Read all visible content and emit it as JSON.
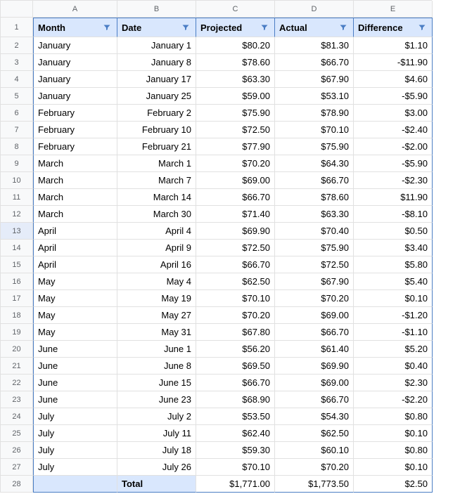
{
  "columns": [
    "A",
    "B",
    "C",
    "D",
    "E"
  ],
  "headers": [
    "Month",
    "Date",
    "Projected",
    "Actual",
    "Difference"
  ],
  "selected_row": 13,
  "rows": [
    {
      "n": 2,
      "month": "January",
      "date": "January 1",
      "proj": "$80.20",
      "act": "$81.30",
      "diff": "$1.10"
    },
    {
      "n": 3,
      "month": "January",
      "date": "January 8",
      "proj": "$78.60",
      "act": "$66.70",
      "diff": "-$11.90"
    },
    {
      "n": 4,
      "month": "January",
      "date": "January 17",
      "proj": "$63.30",
      "act": "$67.90",
      "diff": "$4.60"
    },
    {
      "n": 5,
      "month": "January",
      "date": "January 25",
      "proj": "$59.00",
      "act": "$53.10",
      "diff": "-$5.90"
    },
    {
      "n": 6,
      "month": "February",
      "date": "February 2",
      "proj": "$75.90",
      "act": "$78.90",
      "diff": "$3.00"
    },
    {
      "n": 7,
      "month": "February",
      "date": "February 10",
      "proj": "$72.50",
      "act": "$70.10",
      "diff": "-$2.40"
    },
    {
      "n": 8,
      "month": "February",
      "date": "February 21",
      "proj": "$77.90",
      "act": "$75.90",
      "diff": "-$2.00"
    },
    {
      "n": 9,
      "month": "March",
      "date": "March 1",
      "proj": "$70.20",
      "act": "$64.30",
      "diff": "-$5.90"
    },
    {
      "n": 10,
      "month": "March",
      "date": "March 7",
      "proj": "$69.00",
      "act": "$66.70",
      "diff": "-$2.30"
    },
    {
      "n": 11,
      "month": "March",
      "date": "March 14",
      "proj": "$66.70",
      "act": "$78.60",
      "diff": "$11.90"
    },
    {
      "n": 12,
      "month": "March",
      "date": "March 30",
      "proj": "$71.40",
      "act": "$63.30",
      "diff": "-$8.10"
    },
    {
      "n": 13,
      "month": "April",
      "date": "April 4",
      "proj": "$69.90",
      "act": "$70.40",
      "diff": "$0.50"
    },
    {
      "n": 14,
      "month": "April",
      "date": "April 9",
      "proj": "$72.50",
      "act": "$75.90",
      "diff": "$3.40"
    },
    {
      "n": 15,
      "month": "April",
      "date": "April 16",
      "proj": "$66.70",
      "act": "$72.50",
      "diff": "$5.80"
    },
    {
      "n": 16,
      "month": "May",
      "date": "May 4",
      "proj": "$62.50",
      "act": "$67.90",
      "diff": "$5.40"
    },
    {
      "n": 17,
      "month": "May",
      "date": "May 19",
      "proj": "$70.10",
      "act": "$70.20",
      "diff": "$0.10"
    },
    {
      "n": 18,
      "month": "May",
      "date": "May 27",
      "proj": "$70.20",
      "act": "$69.00",
      "diff": "-$1.20"
    },
    {
      "n": 19,
      "month": "May",
      "date": "May 31",
      "proj": "$67.80",
      "act": "$66.70",
      "diff": "-$1.10"
    },
    {
      "n": 20,
      "month": "June",
      "date": "June 1",
      "proj": "$56.20",
      "act": "$61.40",
      "diff": "$5.20"
    },
    {
      "n": 21,
      "month": "June",
      "date": "June 8",
      "proj": "$69.50",
      "act": "$69.90",
      "diff": "$0.40"
    },
    {
      "n": 22,
      "month": "June",
      "date": "June 15",
      "proj": "$66.70",
      "act": "$69.00",
      "diff": "$2.30"
    },
    {
      "n": 23,
      "month": "June",
      "date": "June 23",
      "proj": "$68.90",
      "act": "$66.70",
      "diff": "-$2.20"
    },
    {
      "n": 24,
      "month": "July",
      "date": "July 2",
      "proj": "$53.50",
      "act": "$54.30",
      "diff": "$0.80"
    },
    {
      "n": 25,
      "month": "July",
      "date": "July 11",
      "proj": "$62.40",
      "act": "$62.50",
      "diff": "$0.10"
    },
    {
      "n": 26,
      "month": "July",
      "date": "July 18",
      "proj": "$59.30",
      "act": "$60.10",
      "diff": "$0.80"
    },
    {
      "n": 27,
      "month": "July",
      "date": "July 26",
      "proj": "$70.10",
      "act": "$70.20",
      "diff": "$0.10"
    }
  ],
  "total": {
    "n": 28,
    "label": "Total",
    "proj": "$1,771.00",
    "act": "$1,773.50",
    "diff": "$2.50"
  }
}
